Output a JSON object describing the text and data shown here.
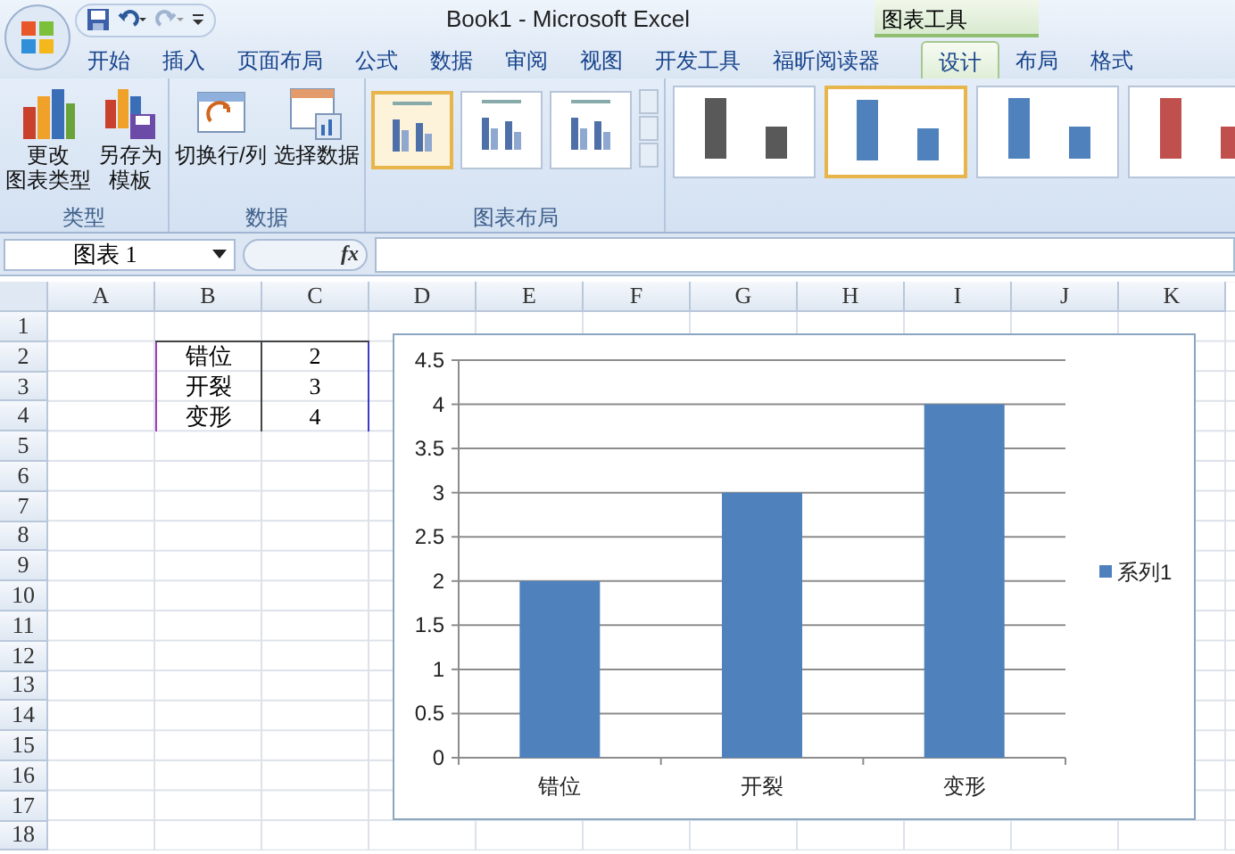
{
  "window": {
    "title": "Book1 - Microsoft Excel",
    "context_tab_group": "图表工具"
  },
  "tabs": [
    {
      "label": "开始",
      "selected": false
    },
    {
      "label": "插入",
      "selected": false
    },
    {
      "label": "页面布局",
      "selected": false
    },
    {
      "label": "公式",
      "selected": false
    },
    {
      "label": "数据",
      "selected": false
    },
    {
      "label": "审阅",
      "selected": false
    },
    {
      "label": "视图",
      "selected": false
    },
    {
      "label": "开发工具",
      "selected": false
    },
    {
      "label": "福昕阅读器",
      "selected": false
    },
    {
      "label": "设计",
      "selected": true,
      "kind": "context"
    },
    {
      "label": "布局",
      "selected": false,
      "kind": "context"
    },
    {
      "label": "格式",
      "selected": false,
      "kind": "context"
    }
  ],
  "ribbon": {
    "groups": [
      {
        "label": "类型",
        "buttons": [
          {
            "lines": [
              "更改",
              "图表类型"
            ],
            "kind": "chart"
          },
          {
            "lines": [
              "另存为",
              "模板"
            ],
            "kind": "save"
          }
        ]
      },
      {
        "label": "数据",
        "buttons": [
          {
            "lines": [
              "切换行/列"
            ],
            "kind": "switch"
          },
          {
            "lines": [
              "选择数据"
            ],
            "kind": "select"
          }
        ]
      },
      {
        "label": "图表布局",
        "layouts": [
          {
            "selected": true
          },
          {
            "selected": false
          },
          {
            "selected": false
          }
        ]
      }
    ],
    "styles": [
      {
        "color": "#595959",
        "selected": false
      },
      {
        "color": "#4f81bd",
        "selected": true
      },
      {
        "color": "#4f81bd",
        "selected": false
      },
      {
        "color": "#c0504d",
        "selected": false
      }
    ]
  },
  "formula_bar": {
    "name_box": "图表 1",
    "fx": "fx"
  },
  "sheet": {
    "columns": [
      "A",
      "B",
      "C",
      "D",
      "E",
      "F",
      "G",
      "H",
      "I",
      "J",
      "K"
    ],
    "rows": [
      "1",
      "2",
      "3",
      "4",
      "5",
      "6",
      "7",
      "8",
      "9",
      "10",
      "11",
      "12",
      "13",
      "14",
      "15",
      "16",
      "17",
      "18"
    ],
    "cells": [
      [
        "错位",
        "2"
      ],
      [
        "开裂",
        "3"
      ],
      [
        "变形",
        "4"
      ]
    ]
  },
  "chart": {
    "chart_data": {
      "type": "bar",
      "grid": true,
      "categories": [
        "错位",
        "开裂",
        "变形"
      ],
      "series": [
        {
          "name": "系列1",
          "color": "#4f81bd",
          "values": [
            2,
            3,
            4
          ]
        }
      ],
      "ylim": [
        0,
        4.5
      ],
      "yticks": [
        0,
        0.5,
        1,
        1.5,
        2,
        2.5,
        3,
        3.5,
        4,
        4.5
      ]
    }
  }
}
